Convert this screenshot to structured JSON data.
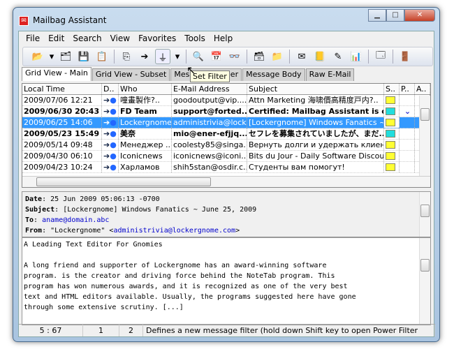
{
  "window": {
    "title": "Mailbag Assistant"
  },
  "menu": [
    "File",
    "Edit",
    "Search",
    "View",
    "Favorites",
    "Tools",
    "Help"
  ],
  "tooltip": "Set Filter",
  "tabs": [
    "Grid View - Main",
    "Grid View - Subset",
    "Message Header",
    "Message Body",
    "Raw E-Mail"
  ],
  "grid": {
    "columns": [
      "Local Time",
      "D..",
      "Who",
      "E-Mail Address",
      "Subject",
      "S..",
      "P..",
      "A.."
    ],
    "rows": [
      {
        "time": "2009/07/06  12:21",
        "who": "噇畫製作?..",
        "email": "goodoutput@vip....",
        "subject": "Attn Marketing 海啸價高精度戸内?..",
        "bold": false,
        "selected": false,
        "status": "read"
      },
      {
        "time": "2009/06/30  20:43",
        "who": "FD Team",
        "email": "support@forted...",
        "subject": "Certified: Mailbag Assistant is c...",
        "bold": true,
        "selected": false,
        "status": "unread",
        "priority": "low"
      },
      {
        "time": "2009/06/25  14:06",
        "who": "Lockergnome",
        "email": "administrivia@lock...",
        "subject": "[Lockergnome] Windows Fanatics ~ ...",
        "bold": false,
        "selected": true,
        "status": "read"
      },
      {
        "time": "2009/05/23  15:49",
        "who": "美奈",
        "email": "mio@ener-efjjq...",
        "subject": "セフレを募集されていましたが、まだ...",
        "bold": true,
        "selected": false,
        "status": "unread"
      },
      {
        "time": "2009/05/14  09:48",
        "who": "Менеджер ...",
        "email": "coolesty85@singa...",
        "subject": "Вернуть долги и удержать клиен...",
        "bold": false,
        "selected": false,
        "status": "read"
      },
      {
        "time": "2009/04/30  06:10",
        "who": "Iconicnews",
        "email": "iconicnews@iconi...",
        "subject": "Bits du Jour - Daily Software Discou...",
        "bold": false,
        "selected": false,
        "status": "read"
      },
      {
        "time": "2009/04/23  10:24",
        "who": "Харламов",
        "email": "shih5stan@osdir.c...",
        "subject": "Студенты вам помогут!",
        "bold": false,
        "selected": false,
        "status": "read"
      }
    ]
  },
  "header": {
    "date_label": "Date",
    "date": "25 Jun 2009 05:06:13 -0700",
    "subject_label": "Subject",
    "subject": "[Lockergnome] Windows Fanatics ~ June 25, 2009",
    "to_label": "To",
    "to": "aname@domain.abc",
    "from_label": "From",
    "from_name": "\"Lockergnome\" <",
    "from_email": "administrivia@lockergnome.com",
    "from_end": ">"
  },
  "body": [
    "A Leading Text Editor For Gnomies",
    "",
    "A long friend and supporter of Lockergnome has an award-winning software",
    "program. is the creator and driving force behind the NoteTab program. This",
    "program has won numerous awards, and it is recognized as one of the very best",
    "text and HTML editors available. Usually, the programs suggested here have gone",
    "through some extensive scrutiny. [...]"
  ],
  "status": {
    "position": "5 : 67",
    "count1": "1",
    "count2": "2",
    "message": "Defines a new message filter (hold down Shift key to open Power Filter"
  }
}
